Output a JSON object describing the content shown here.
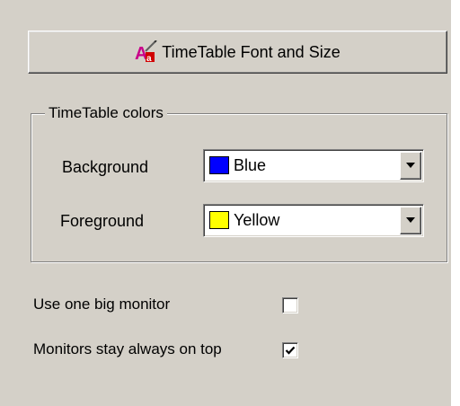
{
  "font_button": {
    "label": "TimeTable Font and Size",
    "icon": "font-icon"
  },
  "colors_group": {
    "title": "TimeTable colors",
    "background": {
      "label": "Background",
      "value": "Blue",
      "swatch_color": "#0000ff"
    },
    "foreground": {
      "label": "Foreground",
      "value": "Yellow",
      "swatch_color": "#ffff00"
    }
  },
  "options": {
    "one_big_monitor": {
      "label": "Use one big monitor",
      "checked": false
    },
    "always_on_top": {
      "label": "Monitors stay always on top",
      "checked": true
    }
  },
  "theme": {
    "face_color": "#d4d0c8"
  }
}
